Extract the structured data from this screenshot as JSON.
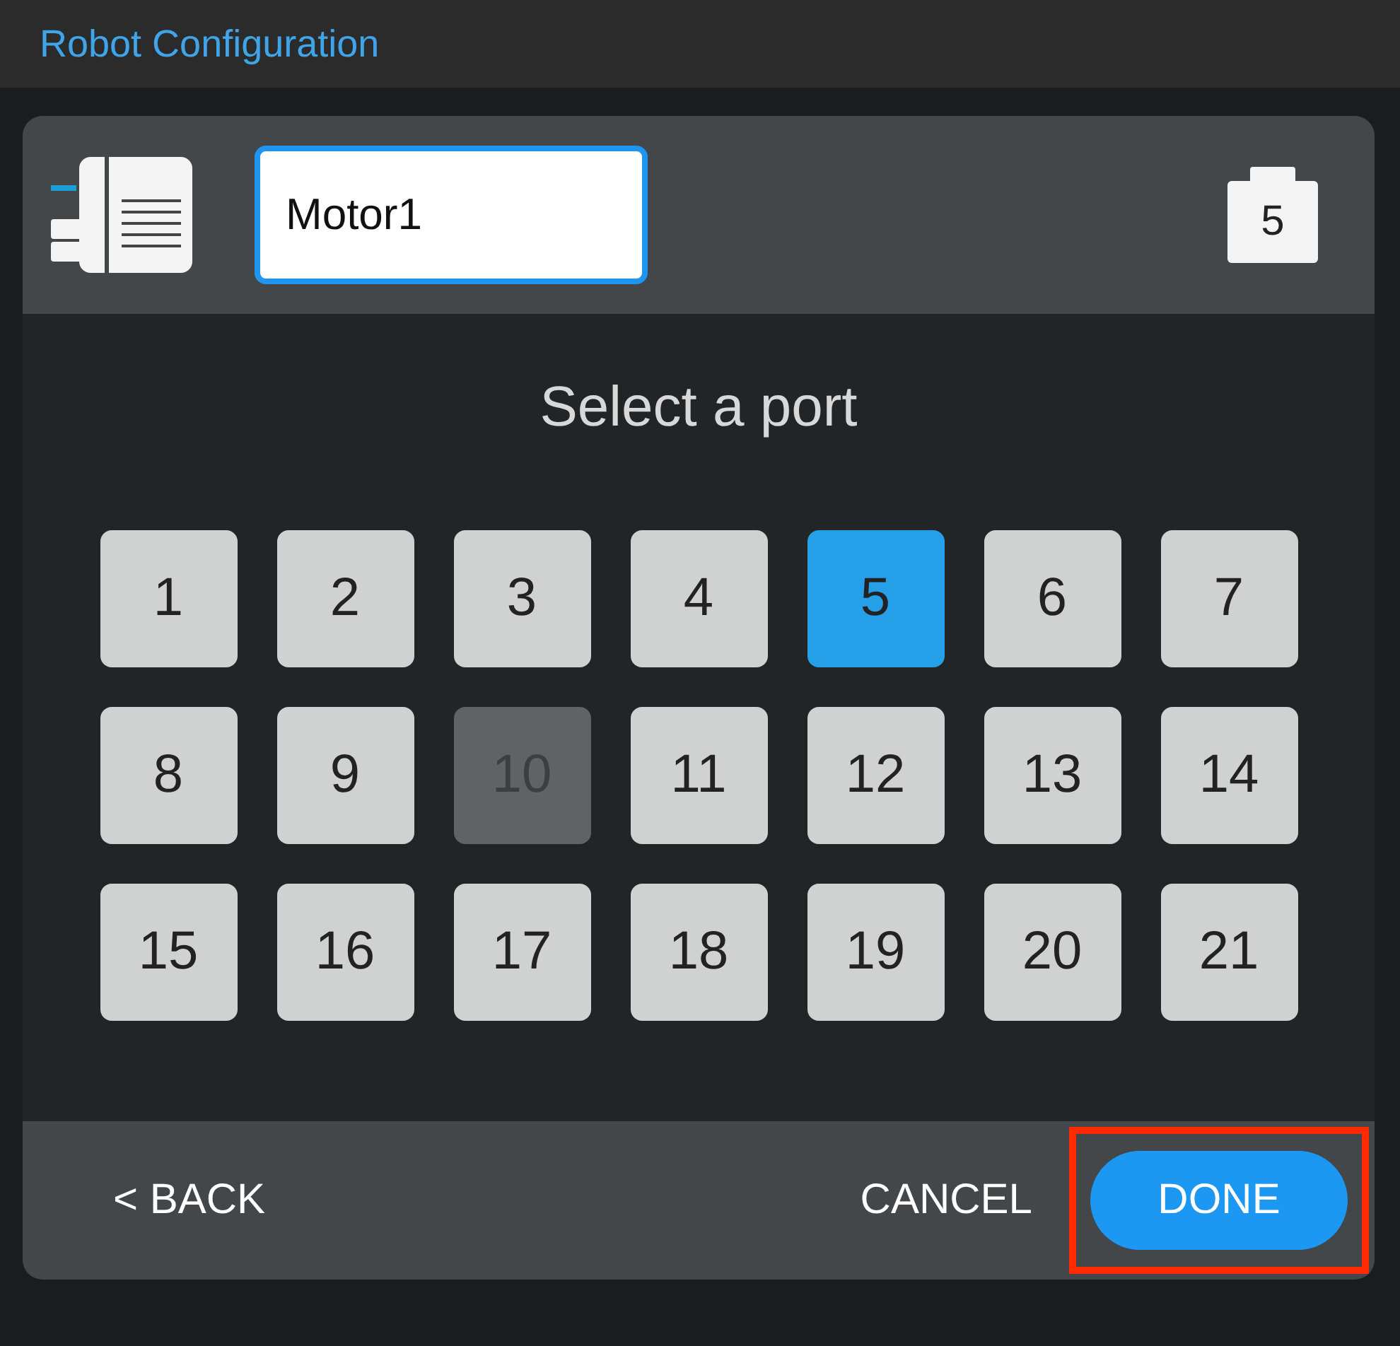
{
  "window": {
    "title": "Robot Configuration"
  },
  "device": {
    "name_value": "Motor1",
    "port_badge": "5"
  },
  "prompt": "Select a port",
  "ports": [
    {
      "label": "1",
      "selected": false,
      "disabled": false
    },
    {
      "label": "2",
      "selected": false,
      "disabled": false
    },
    {
      "label": "3",
      "selected": false,
      "disabled": false
    },
    {
      "label": "4",
      "selected": false,
      "disabled": false
    },
    {
      "label": "5",
      "selected": true,
      "disabled": false
    },
    {
      "label": "6",
      "selected": false,
      "disabled": false
    },
    {
      "label": "7",
      "selected": false,
      "disabled": false
    },
    {
      "label": "8",
      "selected": false,
      "disabled": false
    },
    {
      "label": "9",
      "selected": false,
      "disabled": false
    },
    {
      "label": "10",
      "selected": false,
      "disabled": true
    },
    {
      "label": "11",
      "selected": false,
      "disabled": false
    },
    {
      "label": "12",
      "selected": false,
      "disabled": false
    },
    {
      "label": "13",
      "selected": false,
      "disabled": false
    },
    {
      "label": "14",
      "selected": false,
      "disabled": false
    },
    {
      "label": "15",
      "selected": false,
      "disabled": false
    },
    {
      "label": "16",
      "selected": false,
      "disabled": false
    },
    {
      "label": "17",
      "selected": false,
      "disabled": false
    },
    {
      "label": "18",
      "selected": false,
      "disabled": false
    },
    {
      "label": "19",
      "selected": false,
      "disabled": false
    },
    {
      "label": "20",
      "selected": false,
      "disabled": false
    },
    {
      "label": "21",
      "selected": false,
      "disabled": false
    }
  ],
  "footer": {
    "back": "< BACK",
    "cancel": "CANCEL",
    "done": {
      "label": "DONE",
      "highlighted": true
    }
  }
}
